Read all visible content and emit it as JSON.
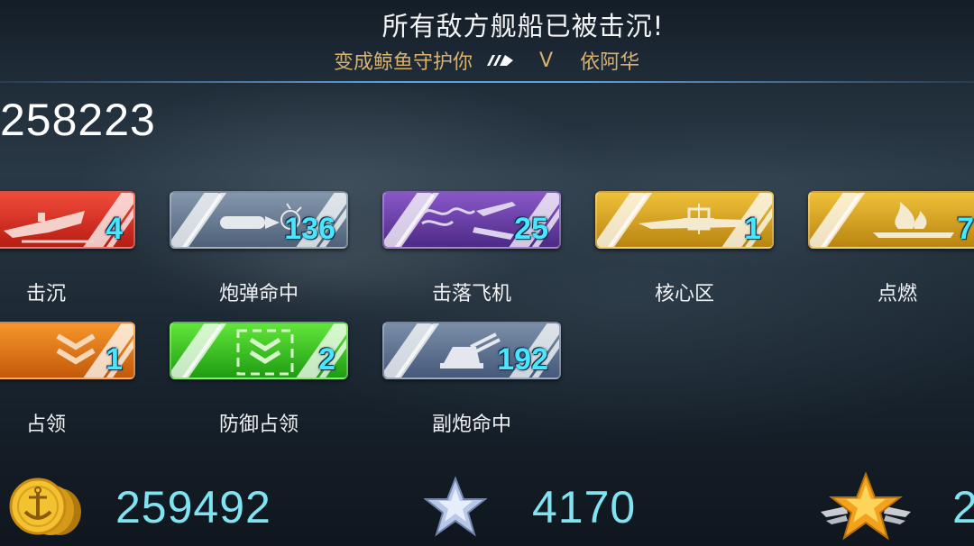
{
  "header": {
    "title": "所有敌方舰船已被击沉!",
    "player_name": "变成鲸鱼守护你",
    "vs_label": "V",
    "opponent_name": "依阿华"
  },
  "total_score": "258223",
  "awards": [
    {
      "name": "击沉",
      "count": "4",
      "color": "#e33a2a",
      "icon": "sinking-ship-icon"
    },
    {
      "name": "炮弹命中",
      "count": "136",
      "color": "#6a7e96",
      "icon": "shell-hit-icon"
    },
    {
      "name": "击落飞机",
      "count": "25",
      "color": "#6c40a8",
      "icon": "plane-shot-down-icon"
    },
    {
      "name": "核心区",
      "count": "1",
      "color": "#d9a520",
      "icon": "citadel-hit-icon"
    },
    {
      "name": "点燃",
      "count": "7",
      "color": "#d9a520",
      "icon": "fire-icon"
    },
    {
      "name": "占领",
      "count": "1",
      "color": "#e0781a",
      "icon": "capture-chevron-icon"
    },
    {
      "name": "防御占领",
      "count": "2",
      "color": "#3ec020",
      "icon": "defend-capture-icon"
    },
    {
      "name": "副炮命中",
      "count": "192",
      "color": "#6a7e96",
      "icon": "secondary-gun-icon"
    }
  ],
  "footer": {
    "credits": "259492",
    "free_exp": "4170",
    "exp": "2"
  }
}
